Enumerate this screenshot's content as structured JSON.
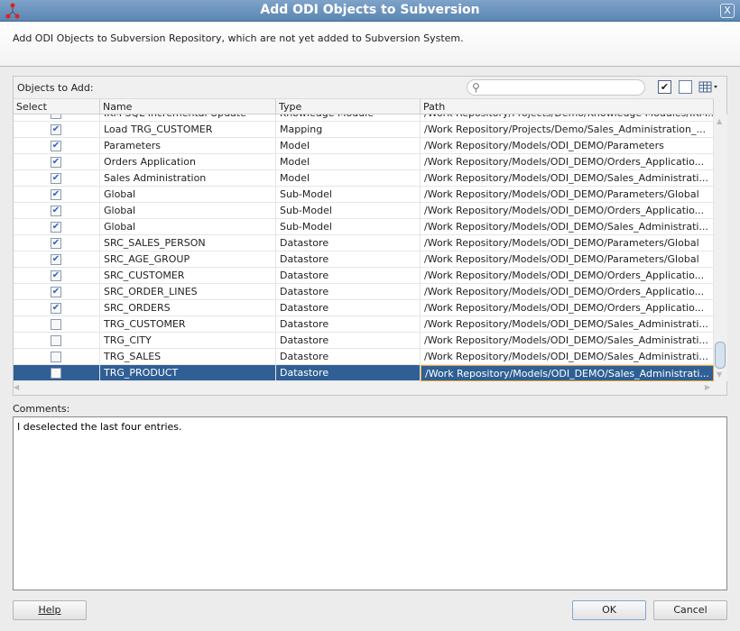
{
  "window": {
    "title": "Add ODI Objects to Subversion",
    "close_label": "X"
  },
  "description": "Add ODI Objects to Subversion Repository, which are not yet added to Subversion System.",
  "panel": {
    "label": "Objects to Add:",
    "search_placeholder": "",
    "search_icon": "search-icon",
    "check_all_icon": "check-all-icon",
    "uncheck_all_icon": "uncheck-all-icon",
    "columns_icon": "table-columns-icon"
  },
  "columns": [
    "Select",
    "Name",
    "Type",
    "Path"
  ],
  "rows": [
    {
      "checked": true,
      "name": "IKM SQL Incremental Update",
      "type": "Knowledge Module",
      "path": "/Work Repository/Projects/Demo/Knowledge Modules/IKM..."
    },
    {
      "checked": true,
      "name": "Load TRG_CUSTOMER",
      "type": "Mapping",
      "path": "/Work Repository/Projects/Demo/Sales_Administration_..."
    },
    {
      "checked": true,
      "name": "Parameters",
      "type": "Model",
      "path": "/Work Repository/Models/ODI_DEMO/Parameters"
    },
    {
      "checked": true,
      "name": "Orders Application",
      "type": "Model",
      "path": "/Work Repository/Models/ODI_DEMO/Orders_Applicatio..."
    },
    {
      "checked": true,
      "name": "Sales Administration",
      "type": "Model",
      "path": "/Work Repository/Models/ODI_DEMO/Sales_Administrati..."
    },
    {
      "checked": true,
      "name": "Global",
      "type": "Sub-Model",
      "path": "/Work Repository/Models/ODI_DEMO/Parameters/Global"
    },
    {
      "checked": true,
      "name": "Global",
      "type": "Sub-Model",
      "path": "/Work Repository/Models/ODI_DEMO/Orders_Applicatio..."
    },
    {
      "checked": true,
      "name": "Global",
      "type": "Sub-Model",
      "path": "/Work Repository/Models/ODI_DEMO/Sales_Administrati..."
    },
    {
      "checked": true,
      "name": "SRC_SALES_PERSON",
      "type": "Datastore",
      "path": "/Work Repository/Models/ODI_DEMO/Parameters/Global"
    },
    {
      "checked": true,
      "name": "SRC_AGE_GROUP",
      "type": "Datastore",
      "path": "/Work Repository/Models/ODI_DEMO/Parameters/Global"
    },
    {
      "checked": true,
      "name": "SRC_CUSTOMER",
      "type": "Datastore",
      "path": "/Work Repository/Models/ODI_DEMO/Orders_Applicatio..."
    },
    {
      "checked": true,
      "name": "SRC_ORDER_LINES",
      "type": "Datastore",
      "path": "/Work Repository/Models/ODI_DEMO/Orders_Applicatio..."
    },
    {
      "checked": true,
      "name": "SRC_ORDERS",
      "type": "Datastore",
      "path": "/Work Repository/Models/ODI_DEMO/Orders_Applicatio..."
    },
    {
      "checked": false,
      "name": "TRG_CUSTOMER",
      "type": "Datastore",
      "path": "/Work Repository/Models/ODI_DEMO/Sales_Administrati..."
    },
    {
      "checked": false,
      "name": "TRG_CITY",
      "type": "Datastore",
      "path": "/Work Repository/Models/ODI_DEMO/Sales_Administrati..."
    },
    {
      "checked": false,
      "name": "TRG_SALES",
      "type": "Datastore",
      "path": "/Work Repository/Models/ODI_DEMO/Sales_Administrati..."
    },
    {
      "checked": false,
      "name": "TRG_PRODUCT",
      "type": "Datastore",
      "path": "/Work Repository/Models/ODI_DEMO/Sales_Administrati...",
      "selected": true
    }
  ],
  "comments": {
    "label": "Comments:",
    "value": "I deselected the last four entries."
  },
  "buttons": {
    "help": "Help",
    "ok": "OK",
    "cancel": "Cancel"
  },
  "colors": {
    "title_bar": "#5b85b3",
    "selection": "#2f5f94",
    "focus_border": "#e8a53a"
  }
}
